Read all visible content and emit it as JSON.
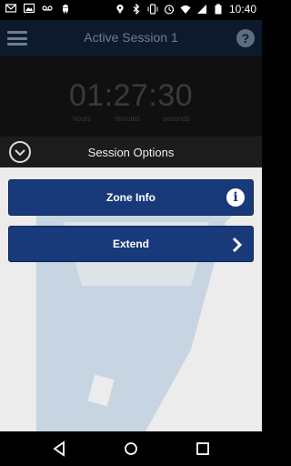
{
  "status_bar": {
    "time": "10:40",
    "left_icons": [
      "mail-icon",
      "photo-icon",
      "voicemail-icon",
      "android-icon"
    ],
    "right_icons": [
      "location-icon",
      "bluetooth-icon",
      "vibrate-icon",
      "alarm-icon",
      "wifi-icon",
      "signal-icon",
      "battery-icon"
    ]
  },
  "app_bar": {
    "title": "Active Session 1",
    "menu_icon": "hamburger-icon",
    "help_label": "?"
  },
  "timer": {
    "display": "01:27:30",
    "hours_label": "hours",
    "minutes_label": "minutes",
    "seconds_label": "seconds"
  },
  "sheet": {
    "title": "Session Options",
    "collapse_icon": "chevron-down-icon"
  },
  "buttons": {
    "zone_info": "Zone Info",
    "zone_info_icon": "i",
    "extend": "Extend"
  },
  "colors": {
    "button_bg": "#18397a",
    "app_bar_bg": "#0c1a2b",
    "sheet_bg": "#ececec",
    "watermark": "#b7c7d9"
  },
  "nav_bar": [
    "back-icon",
    "home-icon",
    "recents-icon"
  ]
}
